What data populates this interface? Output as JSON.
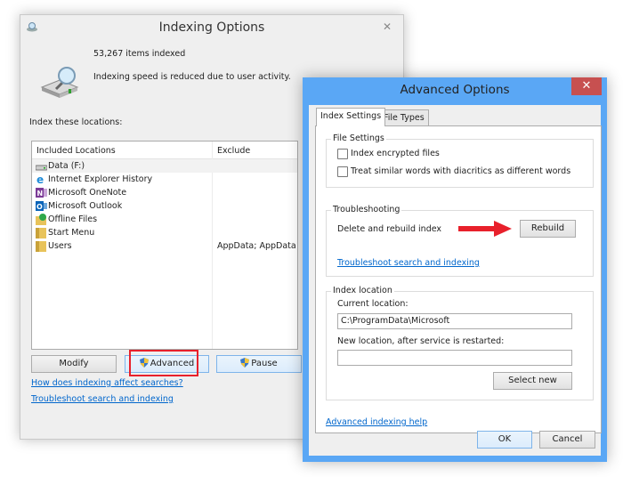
{
  "indexing_window": {
    "title": "Indexing Options",
    "close_label": "✕",
    "items_indexed": "53,267 items indexed",
    "status": "Indexing speed is reduced due to user activity.",
    "index_locations_label": "Index these locations:",
    "columns": {
      "included": "Included Locations",
      "exclude": "Exclude"
    },
    "locations": [
      {
        "name": "Data (F:)",
        "icon": "drive-icon",
        "exclude": ""
      },
      {
        "name": "Internet Explorer History",
        "icon": "internet-explorer-icon",
        "exclude": ""
      },
      {
        "name": "Microsoft OneNote",
        "icon": "onenote-icon",
        "exclude": ""
      },
      {
        "name": "Microsoft Outlook",
        "icon": "outlook-icon",
        "exclude": ""
      },
      {
        "name": "Offline Files",
        "icon": "offline-files-icon",
        "exclude": ""
      },
      {
        "name": "Start Menu",
        "icon": "folder-icon",
        "exclude": ""
      },
      {
        "name": "Users",
        "icon": "folder-icon",
        "exclude": "AppData; AppData"
      }
    ],
    "buttons": {
      "modify": "Modify",
      "advanced": "Advanced",
      "pause": "Pause"
    },
    "links": {
      "how_affects": "How does indexing affect searches?",
      "troubleshoot": "Troubleshoot search and indexing"
    }
  },
  "advanced_window": {
    "title": "Advanced Options",
    "close_label": "✕",
    "tabs": [
      {
        "label": "Index Settings",
        "active": true
      },
      {
        "label": "File Types",
        "active": false
      }
    ],
    "file_settings": {
      "label": "File Settings",
      "options": [
        {
          "label": "Index encrypted files",
          "checked": false
        },
        {
          "label": "Treat similar words with diacritics as different words",
          "checked": false
        }
      ]
    },
    "troubleshooting": {
      "label": "Troubleshooting",
      "delete_rebuild": "Delete and rebuild index",
      "rebuild_button": "Rebuild",
      "link": "Troubleshoot search and indexing"
    },
    "index_location": {
      "label": "Index location",
      "current_label": "Current location:",
      "current_value": "C:\\ProgramData\\Microsoft",
      "new_label": "New location, after service is restarted:",
      "new_value": "",
      "select_new_button": "Select new"
    },
    "help_link": "Advanced indexing help",
    "ok_button": "OK",
    "cancel_button": "Cancel"
  },
  "annotation_color": "#e8202b"
}
